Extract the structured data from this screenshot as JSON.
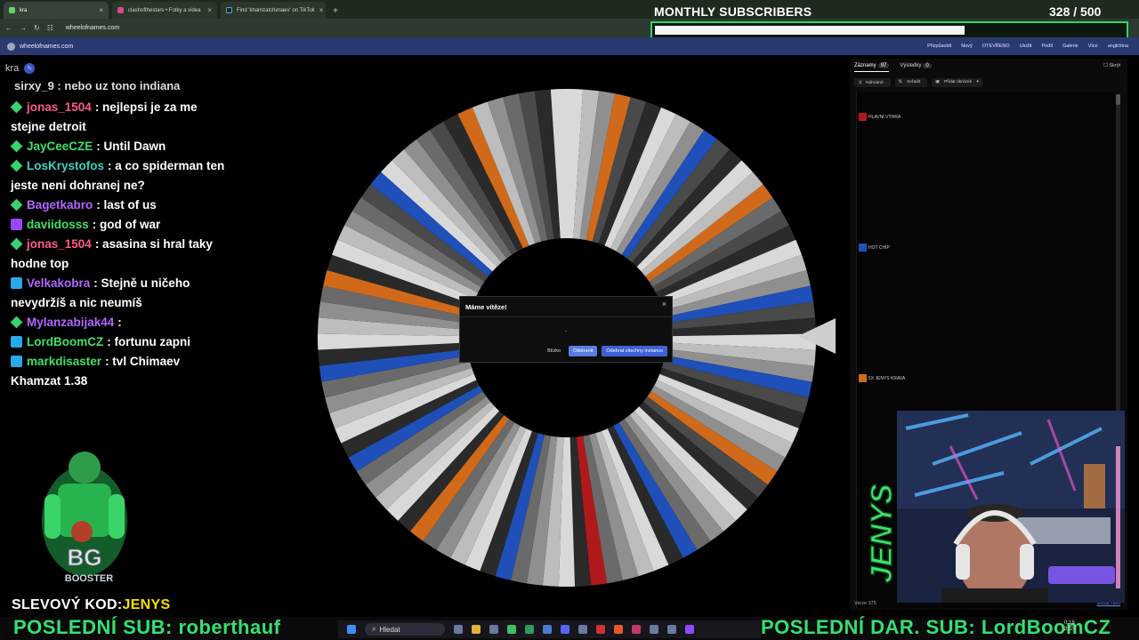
{
  "browser": {
    "tabs": [
      {
        "title": "kra",
        "color": "#6bd16b",
        "active": true
      },
      {
        "title": "clashofthestars • Fotky a videa",
        "color": "#d44c8a",
        "active": false
      },
      {
        "title": "Find 'khamzatchimaev' on TikTok",
        "color": "#222222",
        "active": false
      }
    ],
    "url": "wheelofnames.com"
  },
  "overlay": {
    "subs_title": "MONTHLY SUBSCRIBERS",
    "subs_count": "328  / 500",
    "subs_progress": 0.66
  },
  "app": {
    "site": "wheelofnames.com",
    "menu": [
      "Přizpůsobit",
      "Nový",
      "OTEVŘENO",
      "Uložit",
      "Podíl",
      "Galerie",
      "Více",
      "angličtina"
    ]
  },
  "chat": {
    "header": "kra",
    "cutoff": "sirxy_9 : nebo uz tono indiana",
    "messages": [
      {
        "badge": "green",
        "user": "jonas_1504",
        "color": "#ff5a8a",
        "text": ": nejlepsi je za me stejne detroit"
      },
      {
        "badge": "green",
        "user": "JayCeeCZE",
        "color": "#3fe06a",
        "text": ": Until Dawn"
      },
      {
        "badge": "green",
        "user": "LosKrystofos",
        "color": "#3fd0c4",
        "text": ": a co spiderman ten jeste neni dohranej ne?"
      },
      {
        "badge": "green",
        "user": "Bagetkabro",
        "color": "#b266ff",
        "text": ": last of us"
      },
      {
        "badge": "purple",
        "user": "daviidosss",
        "color": "#3fe06a",
        "text": ": god of war"
      },
      {
        "badge": "green",
        "user": "jonas_1504",
        "color": "#ff5a8a",
        "text": ": asasina si hral taky hodne top"
      },
      {
        "badge": "blue",
        "user": "Velkakobra",
        "color": "#b266ff",
        "text": ": Stejně u ničeho nevydržíš a nic neumíš"
      },
      {
        "badge": "green",
        "user": "Mylanzabijak44",
        "color": "#b266ff",
        "text": ":"
      },
      {
        "badge": "blue",
        "user": "LordBoomCZ",
        "color": "#3fe06a",
        "text": ": fortunu zapni"
      },
      {
        "badge": "blue",
        "user": "markdisaster",
        "color": "#3fe06a",
        "text": ": tvl Chimaev Khamzat 1.38"
      }
    ]
  },
  "promo": {
    "label": "SLEVOVÝ KOD:",
    "code": "JENYS"
  },
  "ticker": {
    "left": "POSLEDNÍ SUB: roberthauf",
    "right": "POSLEDNÍ DAR. SUB: LordBoomCZ"
  },
  "taskbar": {
    "search": "Hledat",
    "time": "0:18",
    "date": "2025"
  },
  "dialog": {
    "title": "Máme vítěze!",
    "winner": ".",
    "close_label": "Blízko",
    "remove_label": "Odstranit",
    "remove_all_label": "Odebrat všechny instance"
  },
  "panel": {
    "tab_entries": "Záznamy",
    "tab_entries_count": "97",
    "tab_results": "Výsledky",
    "tab_results_count": "0",
    "hide": "Skrýt",
    "tools": [
      "Náhodně",
      "Seřadit",
      "Přidat obrázek"
    ],
    "entries": [
      {
        "label": "HLAVNÍ VÝHRA",
        "color": "#b0191b"
      },
      {
        "label": "HOT CHIP",
        "color": "#1f4fb8"
      },
      {
        "label": "5X JENYS KRAVA",
        "color": "#d06a1a"
      }
    ],
    "version": "Verze 375",
    "credit": "sebrat mem"
  },
  "wheel": {
    "segments": 97,
    "palette": [
      "#d9d9d9",
      "#bdbdbd",
      "#8f8f8f",
      "#6a6a6a",
      "#4a4a4a",
      "#2a2a2a"
    ],
    "accent_colors": {
      "orange": "#d06a1a",
      "blue": "#1f4fb8",
      "red": "#b0191b"
    }
  }
}
